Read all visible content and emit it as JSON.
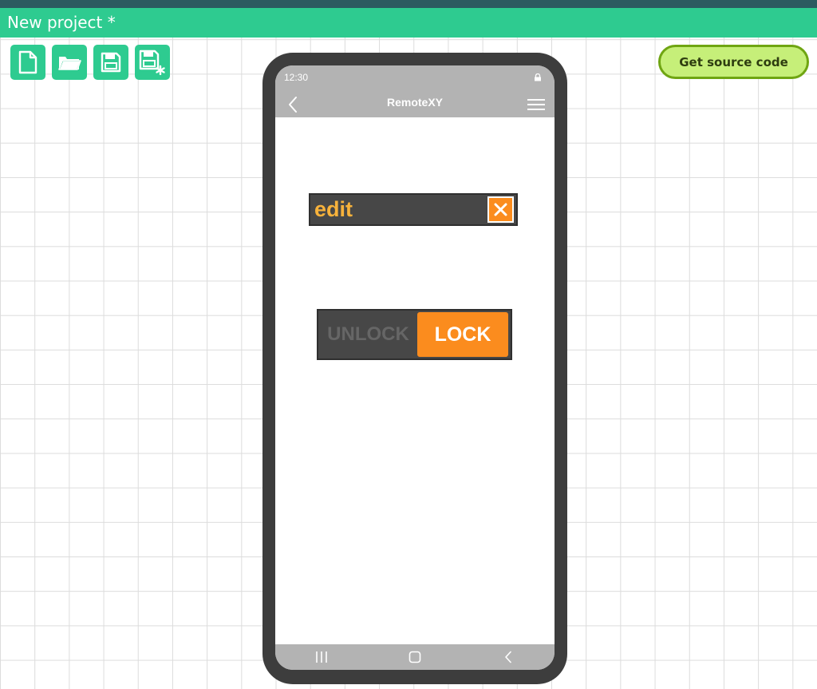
{
  "window": {
    "title": "New project *"
  },
  "toolbar": {
    "buttons": [
      {
        "icon": "new-file-icon"
      },
      {
        "icon": "open-folder-icon"
      },
      {
        "icon": "save-icon"
      },
      {
        "icon": "save-as-icon"
      }
    ],
    "get_source_label": "Get source code"
  },
  "phone": {
    "status": {
      "time": "12:30",
      "icon": "lock-icon"
    },
    "appbar": {
      "title": "RemoteXY",
      "back_icon": "back-icon",
      "menu_icon": "menu-icon"
    },
    "edit_field": {
      "value": "edit",
      "clear_icon": "close-icon"
    },
    "switch": {
      "off_label": "UNLOCK",
      "on_label": "LOCK",
      "state": "on"
    },
    "navbar": {
      "icons": [
        "recents-icon",
        "home-icon",
        "back-icon"
      ]
    }
  },
  "colors": {
    "titlebar": "#2ecb90",
    "top_strip": "#2c5b60",
    "button_green": "#2ecb90",
    "get_source_bg": "#c6ef79",
    "get_source_border": "#6fa512",
    "phone_frame": "#3d3d3d",
    "appbar": "#b3b3b3",
    "widget_bg": "#474747",
    "accent_orange": "#fb8c1e",
    "edit_text": "#f7b23b"
  }
}
